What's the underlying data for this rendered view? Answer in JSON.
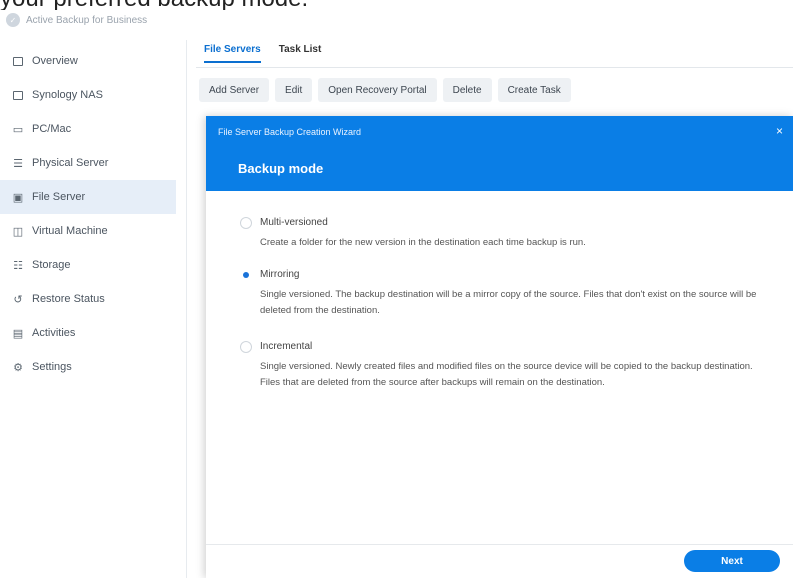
{
  "caption": "your preferred backup mode.",
  "app": {
    "title": "Active Backup for Business"
  },
  "sidebar": {
    "items": [
      {
        "label": "Overview",
        "icon": "overview-icon"
      },
      {
        "label": "Synology NAS",
        "icon": "nas-icon"
      },
      {
        "label": "PC/Mac",
        "icon": "monitor-icon"
      },
      {
        "label": "Physical Server",
        "icon": "server-icon"
      },
      {
        "label": "File Server",
        "icon": "file-server-icon",
        "active": true
      },
      {
        "label": "Virtual Machine",
        "icon": "virtual-machine-icon"
      },
      {
        "label": "Storage",
        "icon": "storage-icon"
      },
      {
        "label": "Restore Status",
        "icon": "restore-icon"
      },
      {
        "label": "Activities",
        "icon": "activities-icon"
      },
      {
        "label": "Settings",
        "icon": "gear-icon"
      }
    ]
  },
  "tabs": [
    {
      "label": "File Servers",
      "active": true
    },
    {
      "label": "Task List",
      "active": false
    }
  ],
  "toolbar": {
    "add_server": "Add Server",
    "edit": "Edit",
    "open_recovery_portal": "Open Recovery Portal",
    "delete": "Delete",
    "create_task": "Create Task"
  },
  "dialog": {
    "wizard_title": "File Server Backup Creation Wizard",
    "close": "×",
    "title": "Backup mode",
    "options": [
      {
        "label": "Multi-versioned",
        "description": "Create a folder for the new version in the destination each time backup is run.",
        "selected": false
      },
      {
        "label": "Mirroring",
        "description": "Single versioned. The backup destination will be a mirror copy of the source. Files that don't exist on the source will be deleted from the destination.",
        "selected": true
      },
      {
        "label": "Incremental",
        "description": "Single versioned. Newly created files and modified files on the source device will be copied to the backup destination. Files that are deleted from the source after backups will remain on the destination.",
        "selected": false
      }
    ],
    "next": "Next"
  },
  "colors": {
    "accent": "#0a7ee6",
    "active_tab": "#0b6fd0",
    "sidebar_active_bg": "#e6eef8"
  }
}
